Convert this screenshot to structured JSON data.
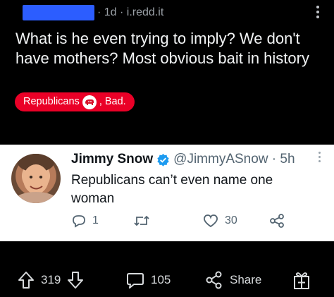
{
  "post": {
    "meta": "· 1d · i.redd.it",
    "title": "What is he even trying to imply? We don't have mothers? Most obvious bait in history",
    "flair_left": "Republicans",
    "flair_right": ", Bad."
  },
  "tweet": {
    "name": "Jimmy Snow",
    "handle": "@JimmyASnow · 5h",
    "text": "Republicans can’t even name one woman",
    "replies": "1",
    "likes": "30"
  },
  "actions": {
    "upvotes": "319",
    "comments": "105",
    "share": "Share"
  },
  "colors": {
    "background": "#000000",
    "flair": "#ea0027",
    "verified": "#1d9bf0",
    "redaction": "#2c5dff"
  }
}
